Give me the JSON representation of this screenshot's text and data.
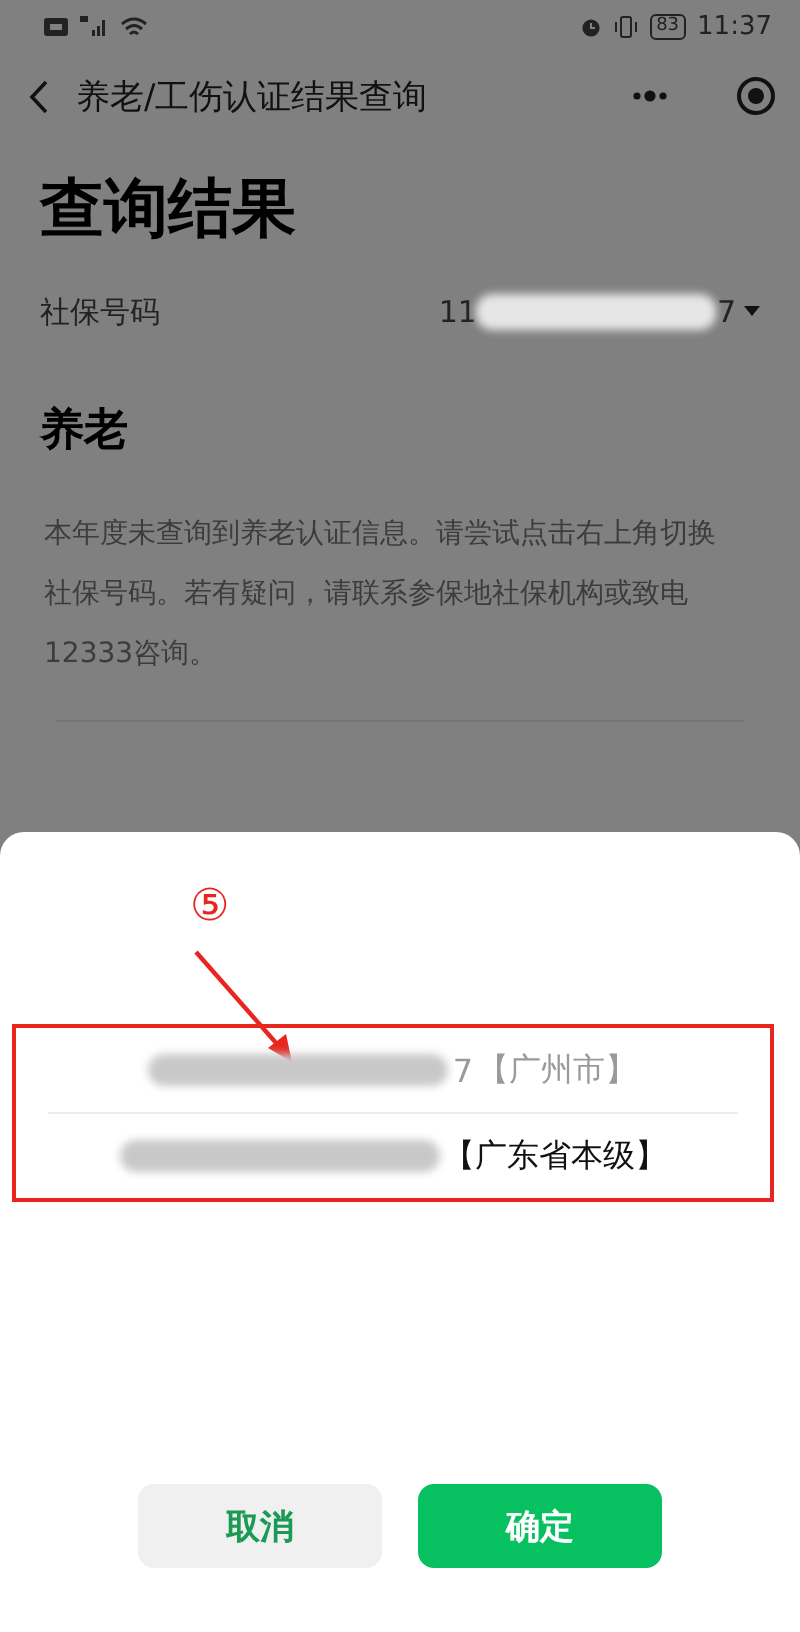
{
  "status_bar": {
    "time": "11:37",
    "battery": "83"
  },
  "nav": {
    "title": "养老/工伤认证结果查询"
  },
  "page": {
    "heading": "查询结果",
    "account": {
      "label": "社保号码",
      "value_start": "11",
      "value_end": "7"
    },
    "section": {
      "title": "养老",
      "message": "本年度未查询到养老认证信息。请尝试点击右上角切换社保号码。若有疑问，请联系参保地社保机构或致电12333咨询。"
    }
  },
  "picker": {
    "annotation": "⑤",
    "options": [
      {
        "number_end": "7",
        "region": "【广州市】",
        "selected": false
      },
      {
        "region": "【广东省本级】",
        "selected": true
      }
    ],
    "buttons": [
      {
        "label": "取消",
        "kind": "cancel"
      },
      {
        "label": "确定",
        "kind": "confirm"
      }
    ]
  }
}
